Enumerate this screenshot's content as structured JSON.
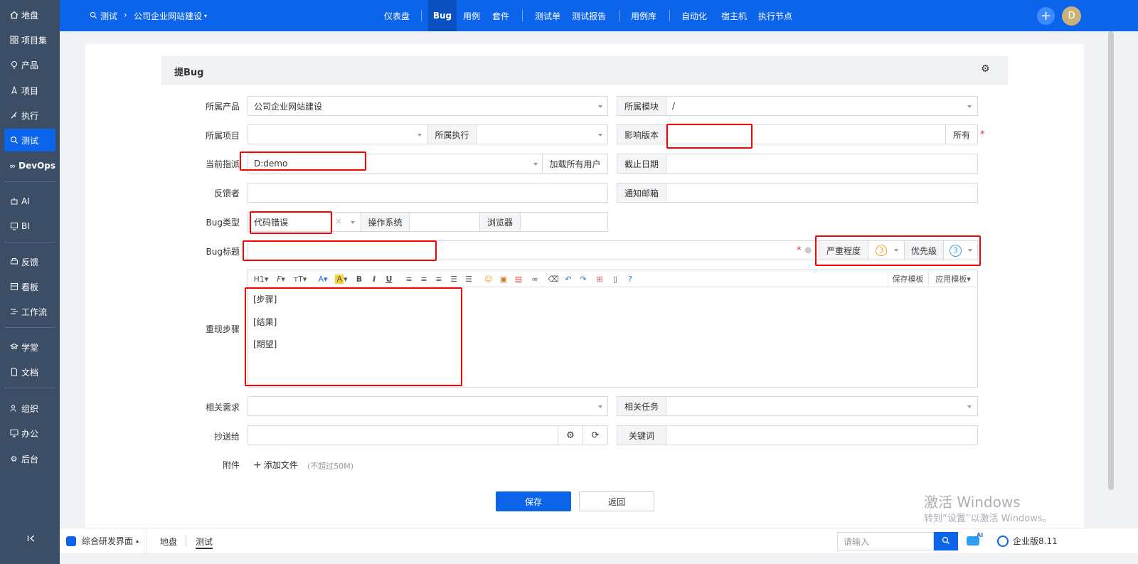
{
  "sidebar": {
    "items": [
      {
        "label": "地盘",
        "icon": "home-icon"
      },
      {
        "label": "项目集",
        "icon": "grid-icon"
      },
      {
        "label": "产品",
        "icon": "bulb-icon"
      },
      {
        "label": "项目",
        "icon": "rocket-icon"
      },
      {
        "label": "执行",
        "icon": "run-icon"
      },
      {
        "label": "测试",
        "icon": "search-icon"
      },
      {
        "label": "DevOps",
        "icon": "infinity-icon"
      },
      {
        "label": "AI",
        "icon": "robot-icon"
      },
      {
        "label": "BI",
        "icon": "chart-icon"
      },
      {
        "label": "反馈",
        "icon": "printer-icon"
      },
      {
        "label": "看板",
        "icon": "board-icon"
      },
      {
        "label": "工作流",
        "icon": "flow-icon"
      },
      {
        "label": "学堂",
        "icon": "school-icon"
      },
      {
        "label": "文档",
        "icon": "doc-icon"
      },
      {
        "label": "组织",
        "icon": "people-icon"
      },
      {
        "label": "办公",
        "icon": "monitor-icon"
      },
      {
        "label": "后台",
        "icon": "gear-icon"
      }
    ],
    "collapse_icon": "collapse-icon"
  },
  "topbar": {
    "breadcrumb_module": "测试",
    "breadcrumb_product": "公司企业网站建设",
    "nav": [
      "仪表盘",
      "Bug",
      "用例",
      "套件",
      "测试单",
      "测试报告",
      "用例库",
      "自动化",
      "宿主机",
      "执行节点"
    ],
    "avatar": "D"
  },
  "form": {
    "title": "提Bug",
    "product_label": "所属产品",
    "product_value": "公司企业网站建设",
    "module_label": "所属模块",
    "module_value": "/",
    "project_label": "所属项目",
    "execution_label": "所属执行",
    "build_label": "影响版本",
    "build_all": "所有",
    "assign_label": "当前指派",
    "assign_value": "D:demo",
    "load_users": "加载所有用户",
    "deadline_label": "截止日期",
    "feedback_label": "反馈者",
    "mail_label": "通知邮箱",
    "type_label": "Bug类型",
    "type_value": "代码错误",
    "os_label": "操作系统",
    "browser_label": "浏览器",
    "title_label": "Bug标题",
    "severity_label": "严重程度",
    "severity_value": "3",
    "priority_label": "优先级",
    "priority_value": "3",
    "steps_label": "重现步骤",
    "toolbar": [
      "H1",
      "F",
      "тT",
      "A",
      "A",
      "B",
      "I",
      "U"
    ],
    "save_template": "保存模板",
    "apply_template": "应用模板",
    "steps_lines": [
      "[步骤]",
      "[结果]",
      "[期望]"
    ],
    "story_label": "相关需求",
    "task_label": "相关任务",
    "cc_label": "抄送给",
    "keywords_label": "关键词",
    "files_label": "附件",
    "add_file": "添加文件",
    "file_limit": "(不超过50M)",
    "save": "保存",
    "back": "返回"
  },
  "bottombar": {
    "app_name": "综合研发界面",
    "crumb1": "地盘",
    "crumb2": "测试",
    "search_placeholder": "请输入",
    "ai_badge": "AI",
    "edition": "企业版8.11"
  },
  "watermark": {
    "line1": "激活 Windows",
    "line2": "转到“设置”以激活 Windows。"
  },
  "colors": {
    "primary": "#0c64eb",
    "sidebar": "#3c4d66",
    "highlight": "#ff0000"
  }
}
